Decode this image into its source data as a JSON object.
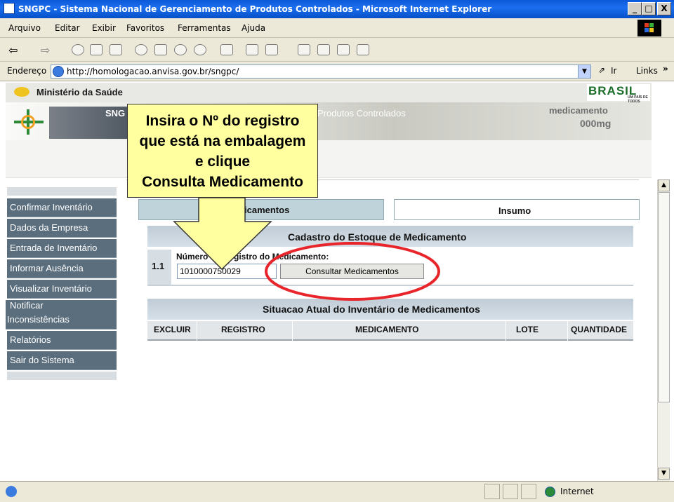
{
  "window": {
    "title": "SNGPC - Sistema Nacional de Gerenciamento de Produtos Controlados - Microsoft Internet Explorer",
    "minimize": "_",
    "maximize": "□",
    "close": "X"
  },
  "menubar": {
    "items": [
      "Arquivo",
      "Editar",
      "Exibir",
      "Favoritos",
      "Ferramentas",
      "Ajuda"
    ]
  },
  "address": {
    "label": "Endereço",
    "url": "http://homologacao.anvisa.gov.br/sngpc/",
    "go": "Ir",
    "links": "Links"
  },
  "header": {
    "ministry": "Ministério da Saúde",
    "brand": "BRASIL",
    "brand_tag": "UM PAÍS DE TODOS",
    "system_short": "SNG",
    "banner_title": "Produtos Controlados",
    "banner_right_1": "medicamento",
    "banner_right_2": "000mg"
  },
  "sidebar": {
    "items": [
      "Confirmar Inventário",
      "Dados da Empresa",
      "Entrada de Inventário",
      "Informar Ausência",
      "Visualizar Inventário",
      "Notificar",
      "Inconsistências",
      "Relatórios",
      "Sair do Sistema"
    ]
  },
  "tabs": {
    "medicamentos": "icamentos",
    "insumo": "Insumo"
  },
  "form": {
    "section_title": "Cadastro do Estoque de Medicamento",
    "step": "1.1",
    "field_label": "Número do Registro do Medicamento:",
    "field_value": "1010000750029",
    "button": "Consultar Medicamentos"
  },
  "inventory": {
    "title": "Situacao Atual do Inventário de Medicamentos",
    "columns": [
      "EXCLUIR",
      "REGISTRO",
      "MEDICAMENTO",
      "LOTE",
      "QUANTIDADE"
    ]
  },
  "callout": {
    "lines": [
      "Insira o Nº do registro",
      "que está na embalagem",
      "e clique",
      "Consulta Medicamento"
    ]
  },
  "status": {
    "zone": "Internet"
  },
  "colors": {
    "titlebar": "#0a58d8",
    "sidebar": "#5a6e7e",
    "highlight": "#e8252a",
    "callout": "#ffffa0"
  }
}
